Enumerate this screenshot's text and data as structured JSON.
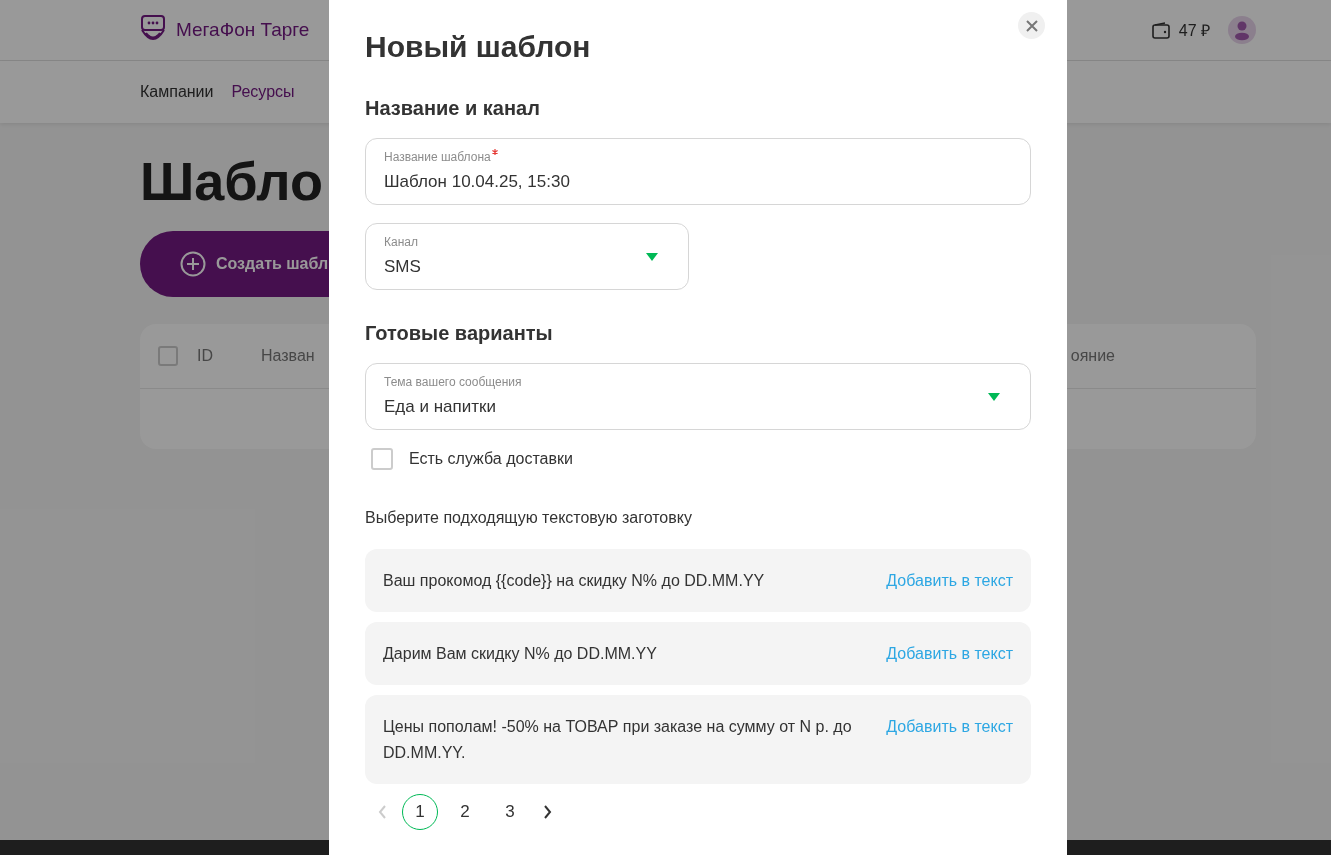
{
  "header": {
    "brand": "МегаФон Тарге",
    "balance": "47 ₽"
  },
  "nav": [
    {
      "label": "Кампании",
      "selected": false
    },
    {
      "label": "Ресурсы",
      "selected": true
    }
  ],
  "page": {
    "title": "Шабло",
    "create_button": "Создать шабл",
    "table": {
      "all_checked": false,
      "columns": [
        "ID",
        "Назван",
        "ояние"
      ]
    }
  },
  "modal": {
    "title": "Новый шаблон",
    "sections": [
      {
        "title": "Название и канал",
        "fields": [
          {
            "kind": "text",
            "label": "Название шаблона",
            "required": true,
            "value": "Шаблон 10.04.25, 15:30",
            "wide": true
          },
          {
            "kind": "select",
            "label": "Канал",
            "required": false,
            "value": "SMS",
            "wide": false
          }
        ]
      },
      {
        "title": "Готовые варианты",
        "fields": [
          {
            "kind": "select",
            "label": "Тема вашего сообщения",
            "required": false,
            "value": "Еда и напитки",
            "wide": true
          }
        ]
      }
    ],
    "checkbox": {
      "label": "Есть служба доставки",
      "checked": false
    },
    "hint": "Выберите подходящую текстовую заготовку",
    "presets": [
      {
        "text": "Ваш прокомод {{code}} на скидку N% до DD.MM.YY",
        "action": "Добавить в текст"
      },
      {
        "text": "Дарим Вам скидку N% до DD.MM.YY",
        "action": "Добавить в текст"
      },
      {
        "text": "Цены пополам! -50% на ТОВАР при заказе на сумму от N р. до DD.MM.YY.",
        "action": "Добавить в текст"
      }
    ],
    "pagination": {
      "prev_disabled": true,
      "next_disabled": false,
      "pages": [
        {
          "label": "1",
          "selected": true
        },
        {
          "label": "2",
          "selected": false
        },
        {
          "label": "3",
          "selected": false
        }
      ]
    }
  }
}
